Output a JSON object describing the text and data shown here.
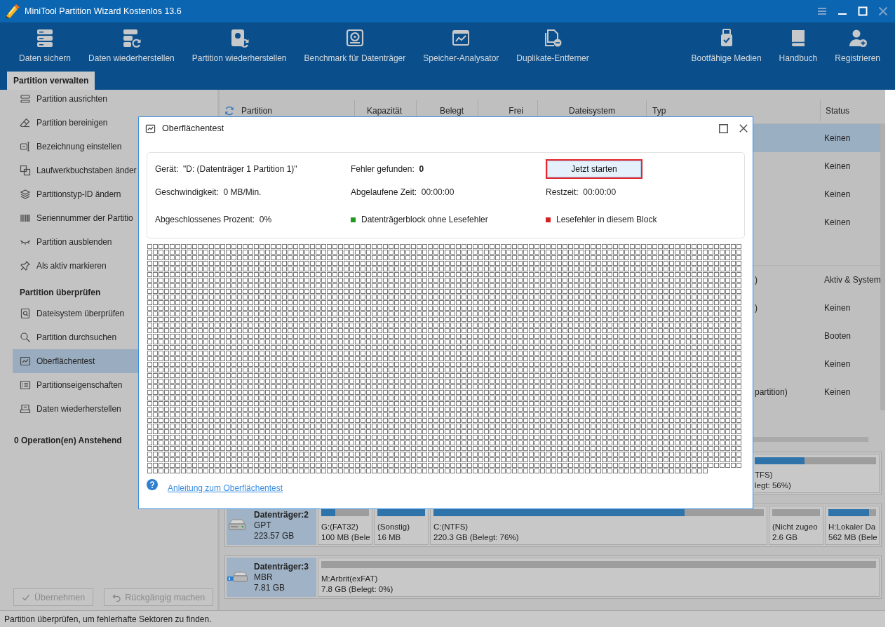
{
  "window": {
    "title": "MiniTool Partition Wizard Kostenlos 13.6"
  },
  "toolbar": {
    "left": [
      {
        "label": "Daten sichern"
      },
      {
        "label": "Daten wiederherstellen"
      },
      {
        "label": "Partition wiederherstellen"
      },
      {
        "label": "Benchmark für Datenträger"
      },
      {
        "label": "Speicher-Analysator"
      },
      {
        "label": "Duplikate-Entferner"
      }
    ],
    "right": [
      {
        "label": "Bootfähige Medien"
      },
      {
        "label": "Handbuch"
      },
      {
        "label": "Registrieren"
      }
    ]
  },
  "tabs": [
    {
      "label": "Partition verwalten",
      "selected": true
    }
  ],
  "sidebar": {
    "groups": [
      {
        "items": [
          {
            "label": "Partition ausrichten",
            "selected": false
          },
          {
            "label": "Partition bereinigen",
            "selected": false
          },
          {
            "label": "Bezeichnung einstellen",
            "selected": false
          },
          {
            "label": "Laufwerkbuchstaben änder",
            "selected": false
          },
          {
            "label": "Partitionstyp-ID ändern",
            "selected": false
          },
          {
            "label": "Seriennummer der Partitio",
            "selected": false
          },
          {
            "label": "Partition ausblenden",
            "selected": false
          },
          {
            "label": "Als aktiv markieren",
            "selected": false
          }
        ]
      },
      {
        "title": "Partition überprüfen",
        "items": [
          {
            "label": "Dateisystem überprüfen",
            "selected": false
          },
          {
            "label": "Partition durchsuchen",
            "selected": false
          },
          {
            "label": "Oberflächentest",
            "selected": true
          },
          {
            "label": "Partitionseigenschaften",
            "selected": false
          },
          {
            "label": "Daten wiederherstellen",
            "selected": false
          }
        ]
      }
    ],
    "pending": "0 Operation(en) Anstehend",
    "actions": [
      {
        "label": "Übernehmen",
        "disabled": true
      },
      {
        "label": "Rückgängig machen",
        "disabled": true
      }
    ]
  },
  "partition_table": {
    "columns": [
      "Partition",
      "Kapazität",
      "Belegt",
      "Frei",
      "Dateisystem",
      "Typ",
      "Status"
    ],
    "groups": [
      {
        "rows": [
          {
            "status": "Keinen",
            "selected": true
          },
          {
            "status": "Keinen",
            "selected": false
          },
          {
            "status": "Keinen",
            "selected": false
          },
          {
            "status": "Keinen",
            "selected": false
          }
        ]
      },
      {
        "rows": [
          {
            "typ": ")",
            "status": "Aktiv & System",
            "selected": false
          },
          {
            "typ": ")",
            "status": "Keinen",
            "selected": false
          },
          {
            "status": "Booten",
            "selected": false
          },
          {
            "status": "Keinen",
            "selected": false
          },
          {
            "typ": "partition)",
            "status": "Keinen",
            "selected": false
          }
        ]
      }
    ]
  },
  "disk_map": {
    "disks": [
      {
        "partitions": [
          {
            "label": "TFS)",
            "usage": "legt: 56%)",
            "level": 0.41
          }
        ]
      },
      {
        "kind": "hdd",
        "name": "Datenträger:2",
        "scheme": "GPT",
        "size": "223.57 GB",
        "partitions": [
          {
            "label": "G:(FAT32)",
            "usage": "100 MB (Bele",
            "level": 0.3
          },
          {
            "label": "(Sonstig)",
            "usage": "16 MB",
            "level": 1
          },
          {
            "label": "C:(NTFS)",
            "usage": "220.3 GB (Belegt: 76%)",
            "level": 0.76
          },
          {
            "label": "(Nicht zugeo",
            "usage": "2.6 GB",
            "level": 0
          },
          {
            "label": "H:Lokaler Da",
            "usage": "562 MB (Bele",
            "level": 0.85
          }
        ]
      },
      {
        "kind": "usb",
        "name": "Datenträger:3",
        "scheme": "MBR",
        "size": "7.81 GB",
        "partitions": [
          {
            "label": "M:Arbrit(exFAT)",
            "usage": "7.8 GB (Belegt: 0%)",
            "level": 0
          }
        ]
      }
    ]
  },
  "dialog": {
    "title": "Oberflächentest",
    "info": [
      {
        "kind": "text",
        "text": "Gerät:  \"D: (Datenträger 1 Partition 1)\""
      },
      {
        "kind": "text",
        "text": "Fehler gefunden:  **0**"
      },
      {
        "kind": "button",
        "label": "Jetzt starten",
        "highlighted": true
      },
      {
        "kind": "text",
        "text": "Geschwindigkeit:  0 MB/Min."
      },
      {
        "kind": "text",
        "text": "Abgelaufene Zeit:  00:00:00"
      },
      {
        "kind": "text",
        "text": "Restzeit:  00:00:00"
      },
      {
        "kind": "text",
        "text": "Abgeschlossenes Prozent:  0%"
      },
      {
        "kind": "legend",
        "label": "Datenträgerblock ohne Lesefehler",
        "color": "#1f9a1f"
      },
      {
        "kind": "legend",
        "label": "Lesefehler in diesem Block",
        "color": "#d32020"
      }
    ],
    "help_link": "Anleitung zum Oberflächentest"
  },
  "status_bar": {
    "text": "Partition überprüfen, um fehlerhafte Sektoren zu finden."
  }
}
